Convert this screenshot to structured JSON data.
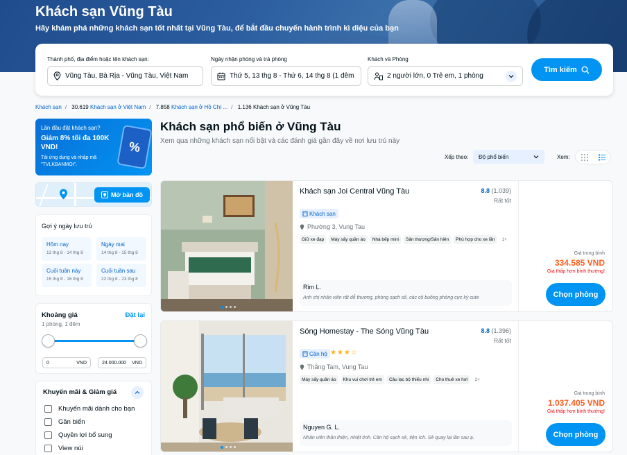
{
  "hero": {
    "title": "Khách sạn Vũng Tàu",
    "subtitle": "Hãy khám phá những khách sạn tốt nhất tại Vũng Tàu, để bắt đầu chuyến hành trình kì diệu của bạn"
  },
  "search": {
    "destination_label": "Thành phố, địa điểm hoặc tên khách sạn:",
    "destination_value": "Vũng Tàu, Bà Rịa - Vũng Tàu, Việt Nam",
    "dates_label": "Ngày nhận phòng và trả phòng",
    "dates_value": "Thứ 5, 13 thg 8 - Thứ 6, 14 thg 8 (1 đêm",
    "guests_label": "Khách và Phòng",
    "guests_value": "2 người lớn, 0 Trẻ em, 1 phòng",
    "button": "Tìm kiếm"
  },
  "breadcrumb": [
    {
      "prefix": "",
      "label": "Khách sạn",
      "link": true
    },
    {
      "prefix": "30.619",
      "label": "Khách sạn ở Việt Nam",
      "link": true
    },
    {
      "prefix": "7.858",
      "label": "Khách sạn ở Hồ Chí ...",
      "link": true
    },
    {
      "prefix": "1.136",
      "label": "Khách sạn ở Vũng Tàu",
      "link": false
    }
  ],
  "promo": {
    "line1": "Lần đầu đặt khách sạn?",
    "line2": "Giảm 8% tối đa 100K VND!",
    "line3": "Tải ứng dụng và nhập mã \"TVLKBANMOI\".",
    "coupon_glyph": "%"
  },
  "map": {
    "button": "Mở bản đồ"
  },
  "stay_suggestions": {
    "title": "Gợi ý ngày lưu trú",
    "items": [
      {
        "label": "Hôm nay",
        "dates": "13 thg 8 - 14 thg 8"
      },
      {
        "label": "Ngày mai",
        "dates": "14 thg 8 - 15 thg 8"
      },
      {
        "label": "Cuối tuần này",
        "dates": "15 thg 8 - 16 thg 8"
      },
      {
        "label": "Cuối tuần sau",
        "dates": "22 thg 8 - 23 thg 8"
      }
    ]
  },
  "price_filter": {
    "title": "Khoảng giá",
    "reset": "Đặt lại",
    "subtitle": "1 phòng, 1 đêm",
    "min": "0",
    "max": "24.000.000",
    "currency": "VND"
  },
  "promo_filter": {
    "title": "Khuyến mãi & Giảm giá",
    "options": [
      "Khuyến mãi dành cho bạn",
      "Gần biển",
      "Quyền lợi bổ sung",
      "View núi"
    ]
  },
  "main": {
    "title": "Khách sạn phổ biến ở Vũng Tàu",
    "subtitle": "Xem qua những khách sạn nổi bật và các đánh giá gần đây về nơi lưu trú này",
    "sort_label": "Xếp theo:",
    "sort_value": "Độ phổ biến",
    "view_label": "Xem:"
  },
  "hotels": [
    {
      "name": "Khách sạn Joi Central Vũng Tàu",
      "score": "8.8",
      "reviews": "(1.039)",
      "score_text": "Rất tốt",
      "type": "Khách sạn",
      "stars": "",
      "location": "Phường 3, Vung Tau",
      "amenities": [
        "Giữ xe đạp",
        "Máy sấy quần áo",
        "Nhà bếp mini",
        "Sân thượng/Sân hiên",
        "Phù hợp cho xe lăn"
      ],
      "more": "1+",
      "reviewer": "Rim L.",
      "review": "Anh chị nhân viên rất dễ thương, phòng sạch sẽ, các cô buồng phòng cực kỳ cute",
      "avg_label": "Giá trung bình",
      "price": "334.585 VND",
      "lower": "Giá thấp hơn bình thường!",
      "button": "Chọn phòng"
    },
    {
      "name": "Sóng Homestay - The Sóng Vũng Tàu",
      "score": "8.8",
      "reviews": "(1.396)",
      "score_text": "Rất tốt",
      "type": "Căn hộ",
      "stars": "★★★☆",
      "location": "Thắng Tam, Vung Tau",
      "amenities": [
        "Máy sấy quần áo",
        "Khu vui chơi trẻ em",
        "Câu lạc bộ thiếu nhi",
        "Cho thuê xe hơi"
      ],
      "more": "2+",
      "reviewer": "Nguyen G. L.",
      "review": "Nhân viên thân thiện, nhiệt tình. Căn hộ sạch sẽ, tiện ích. Sẽ quay lại lần sau ạ.",
      "avg_label": "Giá trung bình",
      "price": "1.037.405 VND",
      "lower": "Giá thấp hơn bình thường!",
      "button": "Chọn phòng"
    }
  ],
  "colors": {
    "primary": "#0194f3",
    "price": "#ff5e1f",
    "alert": "#e7090e",
    "hero": "#2a5c9e"
  }
}
